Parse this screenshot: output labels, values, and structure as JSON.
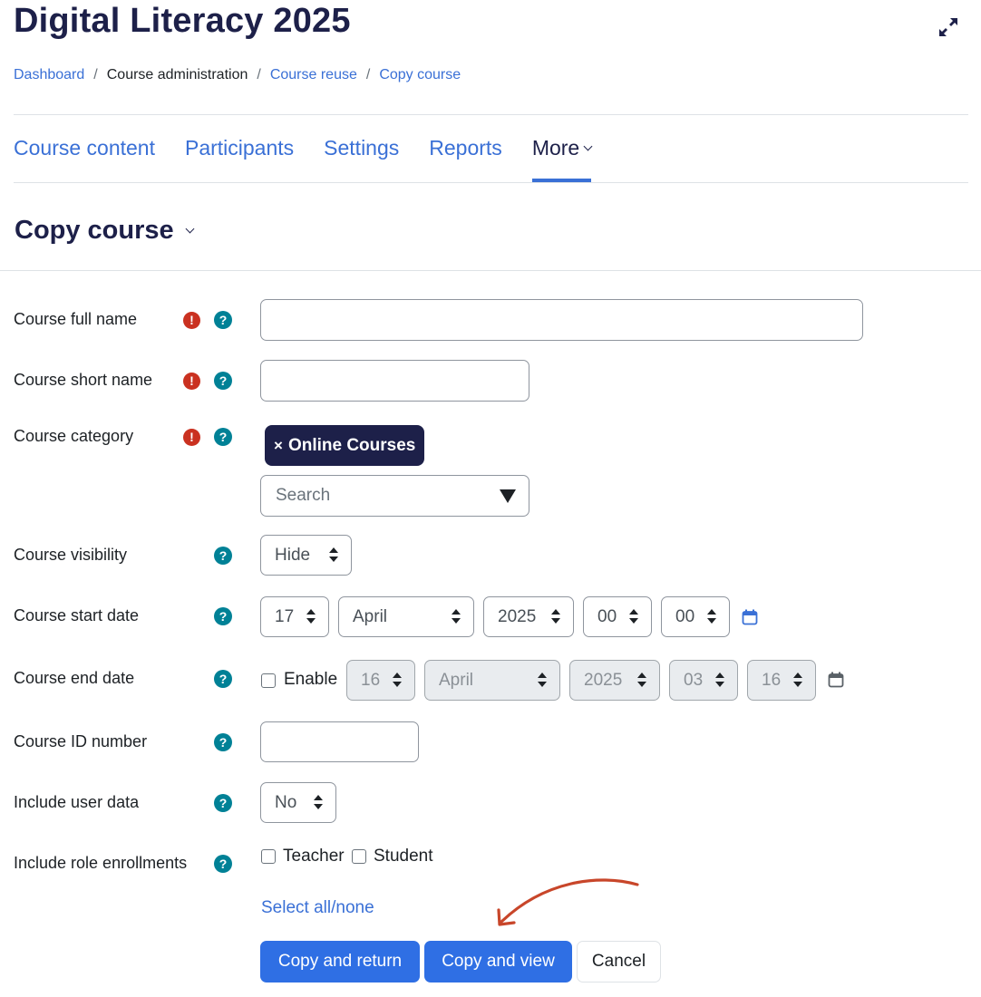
{
  "page": {
    "course_title": "Digital Literacy 2025",
    "heading": "Copy course"
  },
  "breadcrumb": {
    "items": [
      "Dashboard",
      "Course administration",
      "Course reuse",
      "Copy course"
    ],
    "separator": "/"
  },
  "nav": {
    "tabs": [
      "Course content",
      "Participants",
      "Settings",
      "Reports",
      "More"
    ],
    "active": "More"
  },
  "form": {
    "fullname": {
      "label": "Course full name",
      "value": ""
    },
    "shortname": {
      "label": "Course short name",
      "value": ""
    },
    "category": {
      "label": "Course category",
      "selected_tag": "Online Courses",
      "tag_remove": "×",
      "search_placeholder": "Search"
    },
    "visibility": {
      "label": "Course visibility",
      "value": "Hide"
    },
    "start_date": {
      "label": "Course start date",
      "day": "17",
      "month": "April",
      "year": "2025",
      "hour": "00",
      "minute": "00"
    },
    "end_date": {
      "label": "Course end date",
      "enable_label": "Enable",
      "enabled": false,
      "day": "16",
      "month": "April",
      "year": "2025",
      "hour": "03",
      "minute": "16"
    },
    "idnumber": {
      "label": "Course ID number",
      "value": ""
    },
    "userdata": {
      "label": "Include user data",
      "value": "No"
    },
    "role_enrolments": {
      "label": "Include role enrollments",
      "roles": [
        "Teacher",
        "Student"
      ],
      "select_all": "Select all/none"
    }
  },
  "buttons": {
    "copy_return": "Copy and return",
    "copy_view": "Copy and view",
    "cancel": "Cancel"
  },
  "icons": {
    "required": "!",
    "help": "?"
  },
  "colors": {
    "primary": "#2f6fe4",
    "link": "#3a70d6",
    "heading": "#1d2049",
    "required": "#ca3120",
    "help": "#008196",
    "annotation_arrow": "#c8462a"
  }
}
